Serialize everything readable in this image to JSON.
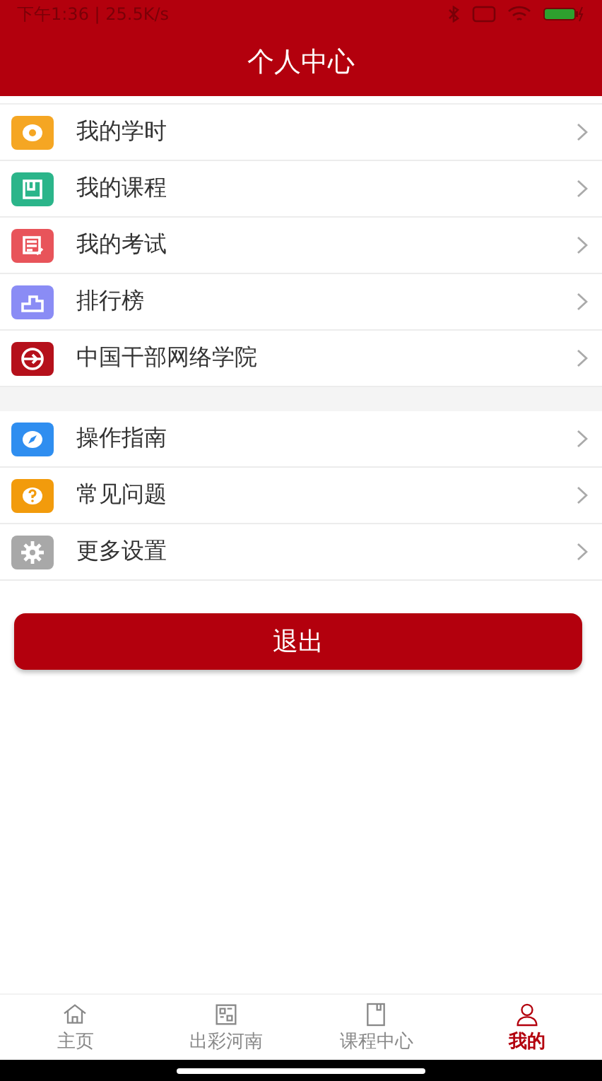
{
  "status_bar": {
    "time": "下午1:36 | 25.5K/s"
  },
  "header": {
    "title": "个人中心"
  },
  "menu_groups": [
    {
      "items": [
        {
          "label": "我的学时",
          "kind": "clock",
          "color": "#f5a623"
        },
        {
          "label": "我的课程",
          "kind": "book",
          "color": "#2bb58a"
        },
        {
          "label": "我的考试",
          "kind": "exam",
          "color": "#e8545a"
        },
        {
          "label": "排行榜",
          "kind": "podium",
          "color": "#8a8cf5"
        },
        {
          "label": "中国干部网络学院",
          "kind": "plane",
          "color": "#b5101b"
        }
      ]
    },
    {
      "items": [
        {
          "label": "操作指南",
          "kind": "compass",
          "color": "#2f8ef0"
        },
        {
          "label": "常见问题",
          "kind": "question",
          "color": "#f29b0c"
        },
        {
          "label": "更多设置",
          "kind": "gear",
          "color": "#a8a8a8"
        }
      ]
    }
  ],
  "logout_button": "退出",
  "tab_bar": [
    {
      "label": "主页",
      "kind": "home",
      "selected": false
    },
    {
      "label": "出彩河南",
      "kind": "qr",
      "selected": false
    },
    {
      "label": "课程中心",
      "kind": "book",
      "selected": false
    },
    {
      "label": "我的",
      "kind": "person",
      "selected": true
    }
  ]
}
